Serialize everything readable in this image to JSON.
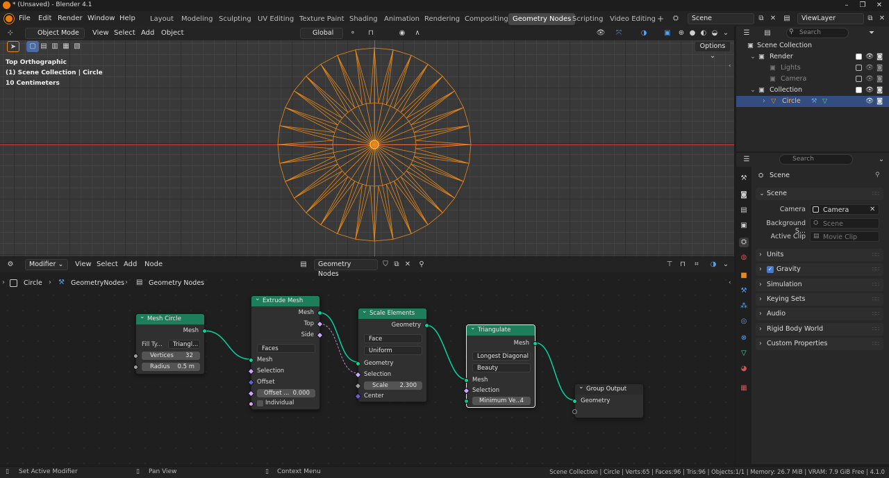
{
  "window": {
    "title": "* (Unsaved) - Blender 4.1",
    "minimize": "–",
    "restore": "❐",
    "close": "✕"
  },
  "menus": [
    "File",
    "Edit",
    "Render",
    "Window",
    "Help"
  ],
  "workspaces": [
    "Layout",
    "Modeling",
    "Sculpting",
    "UV Editing",
    "Texture Paint",
    "Shading",
    "Animation",
    "Rendering",
    "Compositing",
    "Geometry Nodes",
    "Scripting",
    "Video Editing"
  ],
  "workspace_add": "+",
  "scene_name": "Scene",
  "view_layer": "ViewLayer",
  "viewport": {
    "mode": "Object Mode",
    "menus": [
      "View",
      "Select",
      "Add",
      "Object"
    ],
    "orientation": "Global",
    "options_label": "Options",
    "overlay_lines": [
      "Top Orthographic",
      "(1) Scene Collection | Circle",
      "10 Centimeters"
    ]
  },
  "node_editor": {
    "modifier_label": "Modifier",
    "menus": [
      "View",
      "Select",
      "Add",
      "Node"
    ],
    "tree_name": "Geometry Nodes",
    "breadcrumb": [
      "Circle",
      "GeometryNodes",
      "Geometry Nodes"
    ],
    "nodes": {
      "mesh_circle": {
        "title": "Mesh Circle",
        "out_mesh": "Mesh",
        "fill_label": "Fill Ty...",
        "fill_value": "Triangl...",
        "vertices_label": "Vertices",
        "vertices_value": "32",
        "radius_label": "Radius",
        "radius_value": "0.5 m"
      },
      "extrude": {
        "title": "Extrude Mesh",
        "out_mesh": "Mesh",
        "out_top": "Top",
        "out_side": "Side",
        "mode": "Faces",
        "in_mesh": "Mesh",
        "in_selection": "Selection",
        "in_offset": "Offset",
        "offset_scale_label": "Offset ...",
        "offset_scale_value": "0.000",
        "individual": "Individual"
      },
      "scale": {
        "title": "Scale Elements",
        "out_geometry": "Geometry",
        "domain": "Face",
        "mode": "Uniform",
        "in_geometry": "Geometry",
        "in_selection": "Selection",
        "scale_label": "Scale",
        "scale_value": "2.300",
        "in_center": "Center"
      },
      "triangulate": {
        "title": "Triangulate",
        "out_mesh": "Mesh",
        "quad": "Longest Diagonal",
        "ngon": "Beauty",
        "in_mesh": "Mesh",
        "in_selection": "Selection",
        "min_label": "Minimum Ve...",
        "min_value": "4"
      },
      "output": {
        "title": "Group Output",
        "in_geometry": "Geometry"
      }
    }
  },
  "outliner": {
    "search_placeholder": "Search",
    "rows": [
      {
        "label": "Scene Collection"
      },
      {
        "label": "Render"
      },
      {
        "label": "Lights"
      },
      {
        "label": "Camera"
      },
      {
        "label": "Collection"
      },
      {
        "label": "Circle"
      }
    ]
  },
  "properties": {
    "search_placeholder": "Search",
    "context": "Scene",
    "section_scene": "Scene",
    "camera_label": "Camera",
    "camera_value": "Camera",
    "bg_label": "Background S...",
    "bg_placeholder": "Scene",
    "clip_label": "Active Clip",
    "clip_placeholder": "Movie Clip",
    "sections": [
      "Units",
      "Gravity",
      "Simulation",
      "Keying Sets",
      "Audio",
      "Rigid Body World",
      "Custom Properties"
    ]
  },
  "status": {
    "left": "Set Active Modifier",
    "mid": "Pan View",
    "ctx": "Context Menu",
    "right": "Scene Collection | Circle | Verts:65 | Faces:96 | Tris:96 | Objects:1/1 | Memory: 26.7 MiB | VRAM: 7.9 GiB Free | 4.1.0"
  },
  "colors": {
    "accent": "#e87d0d",
    "selection": "#334d80",
    "geometry_socket": "#00d6a3",
    "node_header": "#1e7d5a"
  }
}
